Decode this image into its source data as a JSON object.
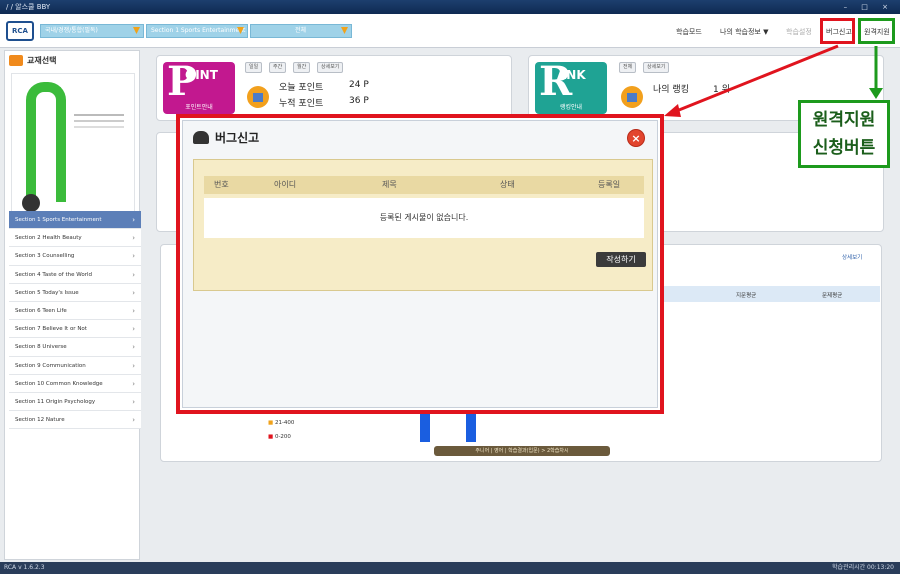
{
  "titlebar": {
    "title": "/ / 알스쿨 BBY",
    "controls": "– □ ×"
  },
  "topbar": {
    "logo": "RCA",
    "selects": [
      "국내/경쟁/통합(필독)",
      "Section 1 Sports Entertainment",
      "전체"
    ],
    "menu": [
      "학습모드",
      "나의 학습정보 ▼",
      "학습설정",
      "버그신고",
      "원격지원"
    ]
  },
  "left": {
    "header": "교재선택",
    "sections": [
      "Section 1 Sports Entertainment",
      "Section 2 Health Beauty",
      "Section 3 Counselling",
      "Section 4 Taste of the World",
      "Section 5 Today's Issue",
      "Section 6 Teen Life",
      "Section 7 Believe It or Not",
      "Section 8 Universe",
      "Section 9 Communication",
      "Section 10 Common Knowledge",
      "Section 11 Origin Psychology",
      "Section 12 Nature"
    ]
  },
  "point_card": {
    "badge_big": "P",
    "badge_small": "OINT",
    "badge_caption": "포인트안내",
    "pills": [
      "일일",
      "주간",
      "월간",
      "상세보기"
    ],
    "today_label": "오늘 포인트",
    "today_value": "24 P",
    "total_label": "누적 포인트",
    "total_value": "36 P"
  },
  "rank_card": {
    "badge_big": "R",
    "badge_small": "ANK",
    "badge_caption": "랭킹안내",
    "pills": [
      "전체",
      "상세보기"
    ],
    "rank_label": "나의 랭킹",
    "rank_value": "1 위"
  },
  "bg": {
    "detail_link": "상세보기",
    "group1": "지문평균",
    "group2": "문제평균",
    "legend1": "21-400",
    "legend2": "0-200",
    "scroll": "주니어 | 영어 | 학습결과(입문) > 2학습차시"
  },
  "modal": {
    "title": "버그신고",
    "close": "×",
    "columns": [
      "번호",
      "아이디",
      "제목",
      "상태",
      "등록일"
    ],
    "empty_message": "등록된 게시물이 없습니다.",
    "write_button": "작성하기"
  },
  "annotation": {
    "line1": "원격지원",
    "line2": "신청버튼"
  },
  "statusbar": {
    "left": "RCA v 1.6.2.3",
    "right": "학습관리시간 00:13:20"
  },
  "colors": {
    "highlight_red": "#e0141e",
    "highlight_green": "#1d9a1d",
    "point_badge": "#c2188f",
    "rank_badge": "#1fa394"
  }
}
